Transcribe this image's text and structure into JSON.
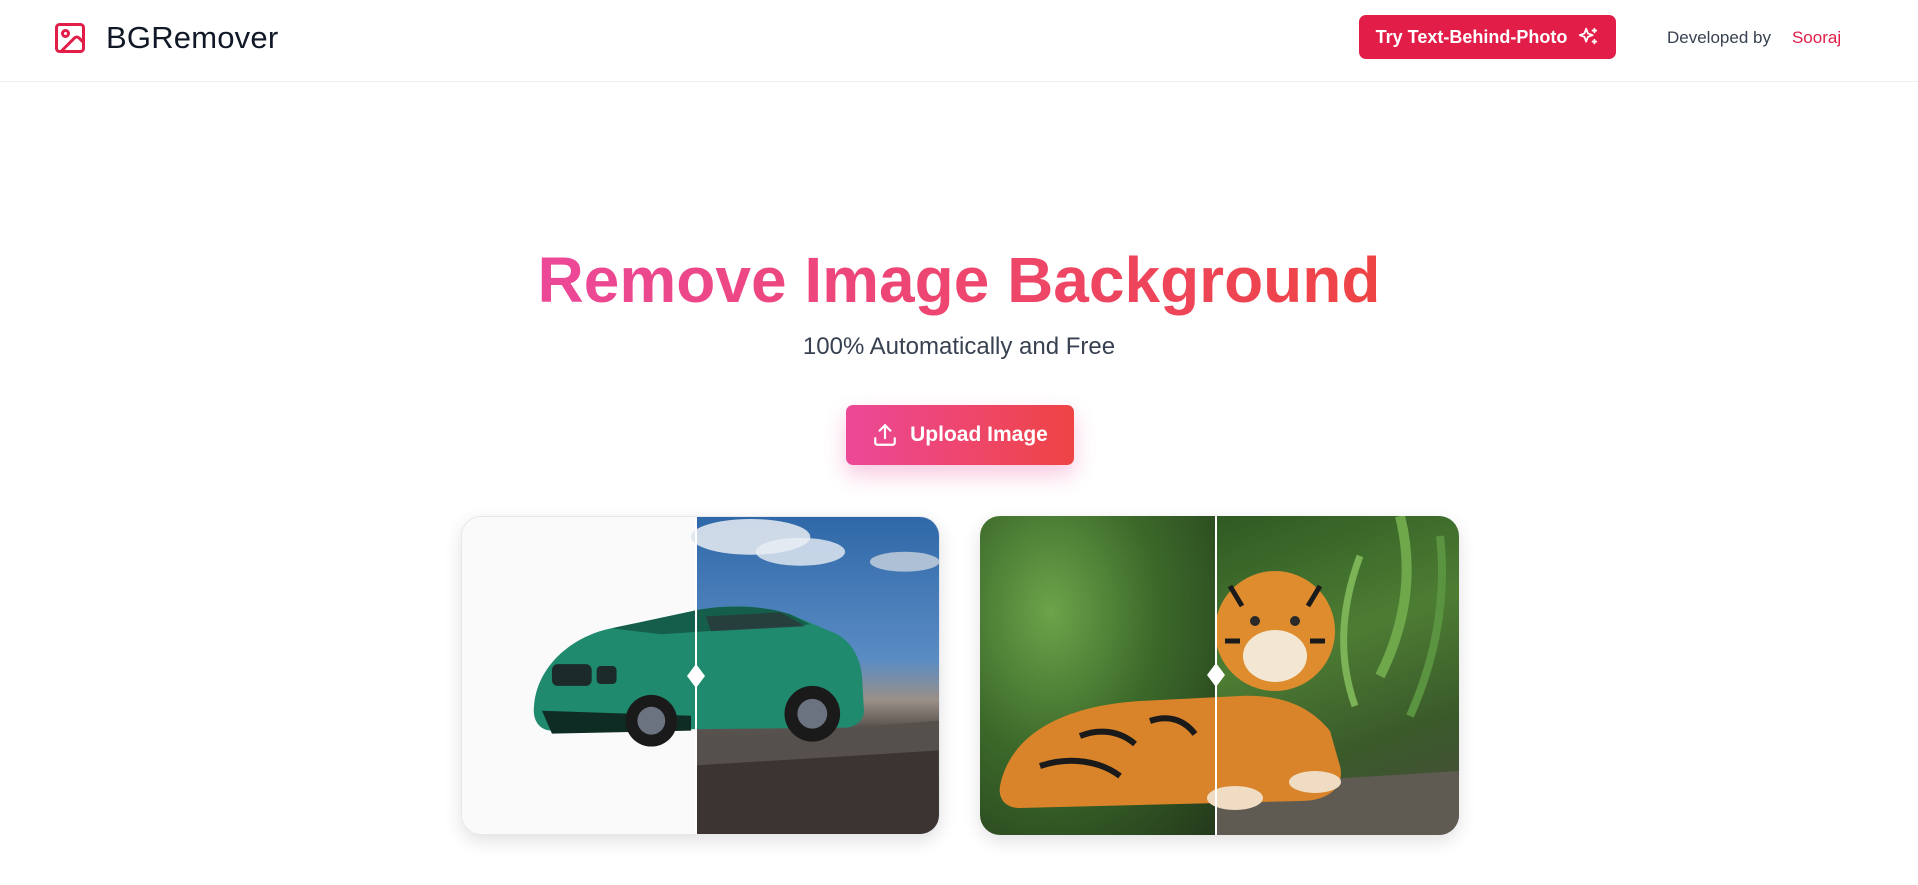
{
  "header": {
    "brand_name": "BGRemover",
    "try_button_label": "Try Text-Behind-Photo",
    "developed_by_label": "Developed by",
    "developer_name": "Sooraj"
  },
  "hero": {
    "title": "Remove Image Background",
    "subtitle": "100% Automatically and Free",
    "upload_label": "Upload Image"
  },
  "examples": [
    {
      "subject": "car",
      "icon": "before-after-compare"
    },
    {
      "subject": "tiger",
      "icon": "before-after-compare"
    }
  ],
  "colors": {
    "accent": "#e11d48",
    "gradient_start": "#ec4899",
    "gradient_end": "#ef4444",
    "text": "#111827",
    "muted": "#374151"
  },
  "icons": {
    "brand": "image-icon",
    "try_button": "sparkles-icon",
    "upload": "upload-icon"
  }
}
